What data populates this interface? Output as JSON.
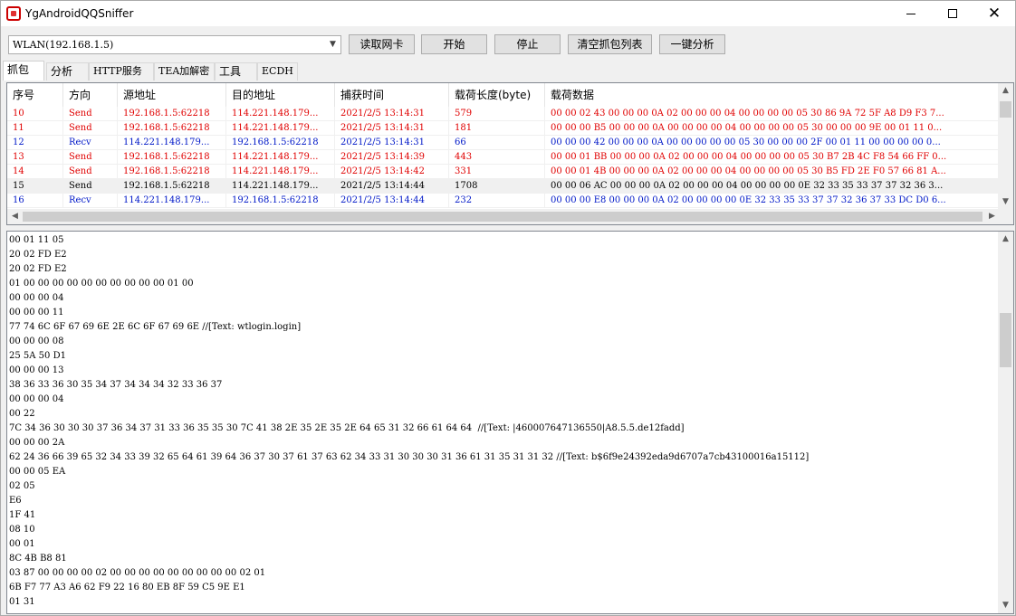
{
  "window": {
    "title": "YgAndroidQQSniffer",
    "minimize_glyph": "—",
    "close_glyph": "✕"
  },
  "toolbar": {
    "adapter_value": "WLAN(192.168.1.5)",
    "buttons": [
      "读取网卡",
      "开始",
      "停止",
      "清空抓包列表",
      "一键分析"
    ]
  },
  "tabs": [
    "抓包",
    "分析",
    "HTTP服务器",
    "TEA加解密",
    "工具",
    "ECDH"
  ],
  "packet_grid": {
    "columns": [
      "序号",
      "方向",
      "源地址",
      "目的地址",
      "捕获时间",
      "载荷长度(byte)",
      "载荷数据"
    ],
    "rows": [
      {
        "id": "10",
        "dir": "Send",
        "src": "192.168.1.5:62218",
        "dst": "114.221.148.179...",
        "time": "2021/2/5 13:14:31",
        "len": "579",
        "data": "00 00 02 43 00 00 00 0A 02 00 00 00 04 00 00 00 00 05 30 86 9A 72 5F A8 D9 F3 7..."
      },
      {
        "id": "11",
        "dir": "Send",
        "src": "192.168.1.5:62218",
        "dst": "114.221.148.179...",
        "time": "2021/2/5 13:14:31",
        "len": "181",
        "data": "00 00 00 B5 00 00 00 0A 00 00 00 00 04 00 00 00 00 05 30 00 00 00 9E 00 01 11 0..."
      },
      {
        "id": "12",
        "dir": "Recv",
        "src": "114.221.148.179...",
        "dst": "192.168.1.5:62218",
        "time": "2021/2/5 13:14:31",
        "len": "66",
        "data": "00 00 00 42 00 00 00 0A 00 00 00 00 00 05 30 00 00 00 2F 00 01 11 00 00 00 00 0..."
      },
      {
        "id": "13",
        "dir": "Send",
        "src": "192.168.1.5:62218",
        "dst": "114.221.148.179...",
        "time": "2021/2/5 13:14:39",
        "len": "443",
        "data": "00 00 01 BB 00 00 00 0A 02 00 00 00 04 00 00 00 00 05 30 B7 2B 4C F8 54 66 FF 0..."
      },
      {
        "id": "14",
        "dir": "Send",
        "src": "192.168.1.5:62218",
        "dst": "114.221.148.179...",
        "time": "2021/2/5 13:14:42",
        "len": "331",
        "data": "00 00 01 4B 00 00 00 0A 02 00 00 00 04 00 00 00 00 05 30 B5 FD 2E F0 57 66 81 A..."
      },
      {
        "id": "15",
        "dir": "Send",
        "src": "192.168.1.5:62218",
        "dst": "114.221.148.179...",
        "time": "2021/2/5 13:14:44",
        "len": "1708",
        "data": "00 00 06 AC 00 00 00 0A 02 00 00 00 04 00 00 00 00 0E 32 33 35 33 37 37 32 36 3..."
      },
      {
        "id": "16",
        "dir": "Recv",
        "src": "114.221.148.179...",
        "dst": "192.168.1.5:62218",
        "time": "2021/2/5 13:14:44",
        "len": "232",
        "data": "00 00 00 E8 00 00 00 0A 02 00 00 00 00 0E 32 33 35 33 37 37 32 36 37 33 DC D0 6..."
      }
    ],
    "selected_row": "15",
    "colors": {
      "send": "#e00000",
      "recv": "#0018c8"
    }
  },
  "hex_view": {
    "lines": [
      "00 01 11 05",
      "20 02 FD E2",
      "20 02 FD E2",
      "01 00 00 00 00 00 00 00 00 00 00 01 00",
      "00 00 00 04",
      "00 00 00 11",
      "77 74 6C 6F 67 69 6E 2E 6C 6F 67 69 6E //[Text: wtlogin.login]",
      "00 00 00 08",
      "25 5A 50 D1",
      "00 00 00 13",
      "38 36 33 36 30 35 34 37 34 34 34 32 33 36 37",
      "00 00 00 04",
      "00 22",
      "7C 34 36 30 30 30 37 36 34 37 31 33 36 35 35 30 7C 41 38 2E 35 2E 35 2E 64 65 31 32 66 61 64 64  //[Text: |460007647136550|A8.5.5.de12fadd]",
      "00 00 00 2A",
      "62 24 36 66 39 65 32 34 33 39 32 65 64 61 39 64 36 37 30 37 61 37 63 62 34 33 31 30 30 30 31 36 61 31 35 31 31 32 //[Text: b$6f9e24392eda9d6707a7cb43100016a15112]",
      "00 00 05 EA",
      "02 05",
      "E6",
      "1F 41",
      "08 10",
      "00 01",
      "8C 4B B8 81",
      "03 87 00 00 00 00 02 00 00 00 00 00 00 00 00 00 02 01",
      "6B F7 77 A3 A6 62 F9 22 16 80 EB 8F 59 C5 9E E1",
      "01 31"
    ]
  }
}
